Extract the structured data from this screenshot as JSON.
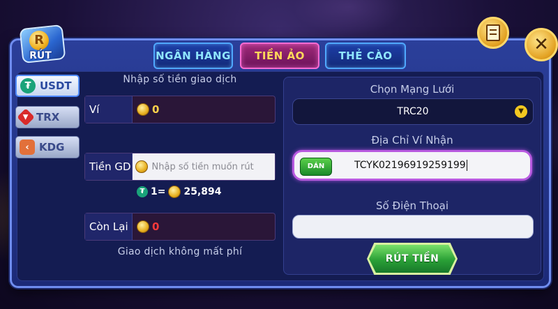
{
  "header": {
    "logo_label": "RÚT",
    "logo_coin_letter": "R"
  },
  "tabs": [
    {
      "label": "NGÂN HÀNG",
      "active": false
    },
    {
      "label": "TIỀN ẢO",
      "active": true
    },
    {
      "label": "THẺ CÀO",
      "active": false
    }
  ],
  "currencies": [
    {
      "label": "USDT",
      "icon": "usdt-icon",
      "active": true
    },
    {
      "label": "TRX",
      "icon": "trx-icon",
      "active": false
    },
    {
      "label": "KDG",
      "icon": "kdg-icon",
      "active": false
    }
  ],
  "left": {
    "caption": "Nhập số tiền giao dịch",
    "wallet": {
      "label": "Ví",
      "value": "0"
    },
    "amount": {
      "label": "Tiền GD",
      "placeholder": "Nhập số tiền muốn rút"
    },
    "rate": {
      "left": "1=",
      "right": "25,894"
    },
    "remaining": {
      "label": "Còn Lại",
      "value": "0"
    },
    "fee_note": "Giao dịch không mất phí"
  },
  "right": {
    "network_caption": "Chọn Mạng Lưới",
    "network_value": "TRC20",
    "address_caption": "Địa Chỉ Ví Nhận",
    "paste_label": "DÁN",
    "address_value": "TCYK02196919259199",
    "phone_caption": "Số Điện Thoại",
    "phone_value": "",
    "submit_label": "RÚT TIỀN"
  },
  "colors": {
    "active_tab_text": "#ffd85a",
    "inactive_tab_text": "#8fe6ff",
    "wallet_value": "#ffd24a",
    "remaining_value": "#ff3a3a",
    "usdt_green": "#1aa37a"
  }
}
